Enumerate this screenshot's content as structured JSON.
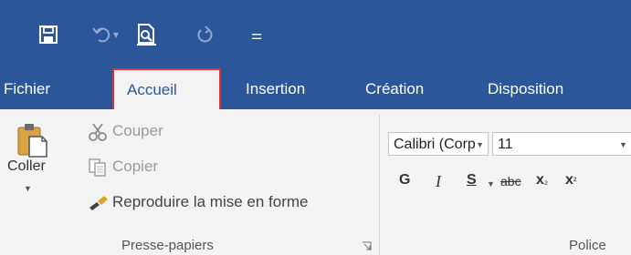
{
  "qat": {
    "icons": [
      "save-icon",
      "undo-icon",
      "print-preview-icon",
      "redo-icon",
      "customize-icon"
    ],
    "undo_arrow": "▾",
    "customize_glyph": "⚌"
  },
  "tabs": [
    {
      "label": "Fichier"
    },
    {
      "label": "Accueil",
      "active": true
    },
    {
      "label": "Insertion"
    },
    {
      "label": "Création"
    },
    {
      "label": "Disposition"
    }
  ],
  "clipboard": {
    "paste_label": "Coller",
    "cut_label": "Couper",
    "copy_label": "Copier",
    "format_painter_label": "Reproduire la mise en forme",
    "group_label": "Presse-papiers"
  },
  "font": {
    "font_name": "Calibri (Corp",
    "font_size": "11",
    "bold": "G",
    "italic": "I",
    "underline": "S",
    "strikethrough": "abc",
    "subscript": "x",
    "subscript_mark": "₂",
    "superscript": "x",
    "superscript_mark": "²",
    "group_label": "Police"
  },
  "colors": {
    "ribbon_blue": "#2b579a",
    "active_outline": "#e03030",
    "ribbon_bg": "#f3f3f3"
  }
}
